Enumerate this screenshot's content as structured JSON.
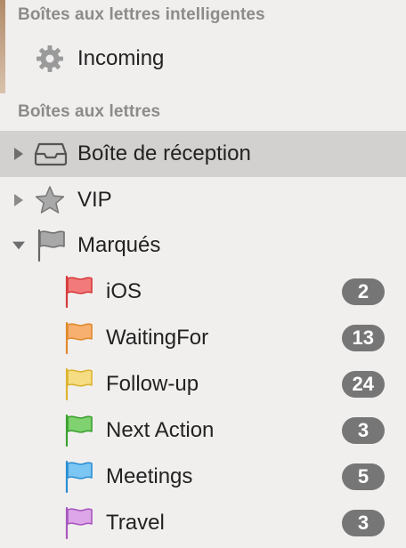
{
  "smart_mailboxes": {
    "header": "Boîtes aux lettres intelligentes",
    "items": [
      {
        "label": "Incoming",
        "icon": "gear-icon"
      }
    ]
  },
  "mailboxes": {
    "header": "Boîtes aux lettres",
    "inbox": {
      "label": "Boîte de réception",
      "icon": "inbox-tray-icon",
      "selected": true
    },
    "vip": {
      "label": "VIP",
      "icon": "star-icon"
    },
    "flagged": {
      "label": "Marqués",
      "icon": "flag-icon",
      "expanded": true
    },
    "flags": [
      {
        "label": "iOS",
        "count": "2",
        "color": "#f05a5a"
      },
      {
        "label": "WaitingFor",
        "count": "13",
        "color": "#f59a3c"
      },
      {
        "label": "Follow-up",
        "count": "24",
        "color": "#f2cc3a"
      },
      {
        "label": "Next Action",
        "count": "3",
        "color": "#4cbf3c"
      },
      {
        "label": "Meetings",
        "count": "5",
        "color": "#3aa6ea"
      },
      {
        "label": "Travel",
        "count": "3",
        "color": "#c77ad6"
      }
    ]
  },
  "colors": {
    "selected_row": "#d3d1d0",
    "badge": "#767676",
    "section_header": "#8d8b8a"
  }
}
